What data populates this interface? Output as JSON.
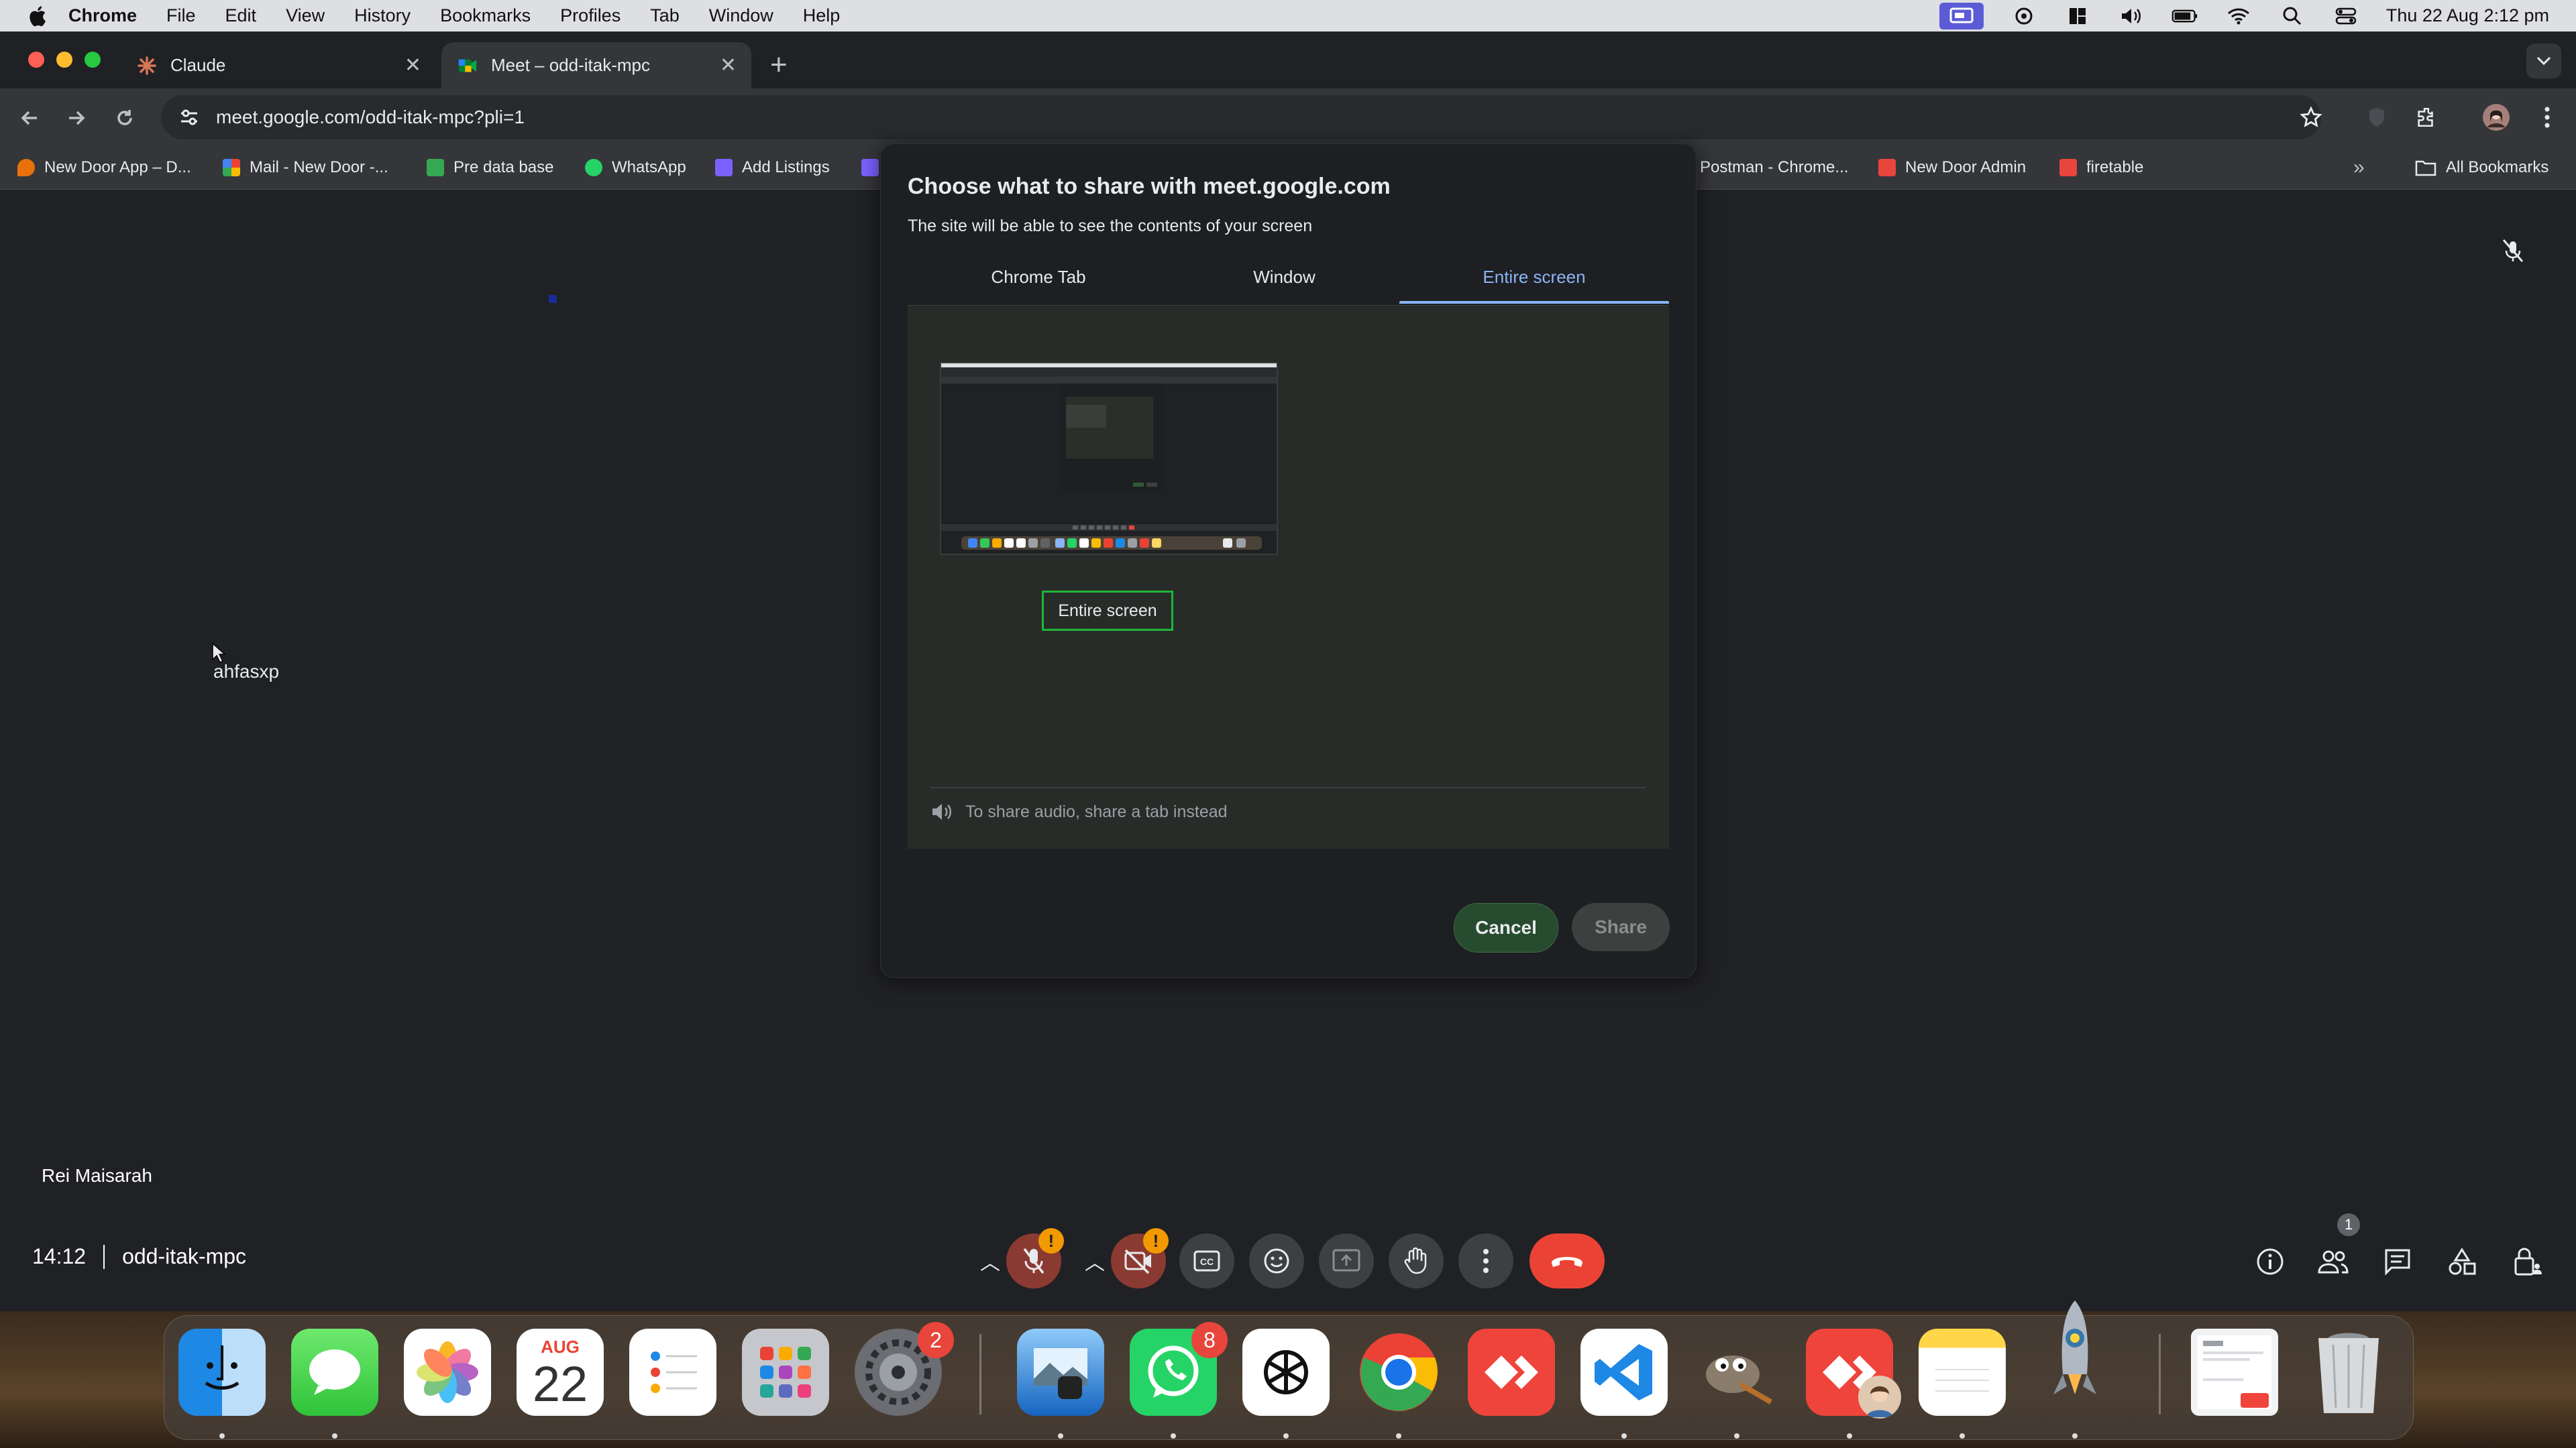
{
  "menubar": {
    "app_name": "Chrome",
    "items": [
      "File",
      "Edit",
      "View",
      "History",
      "Bookmarks",
      "Profiles",
      "Tab",
      "Window",
      "Help"
    ],
    "clock": "Thu 22 Aug  2:12 pm"
  },
  "tabs": [
    {
      "title": "Claude",
      "icon": "claude-icon"
    },
    {
      "title": "Meet – odd-itak-mpc",
      "icon": "google-meet-icon",
      "active": true
    }
  ],
  "address_bar": {
    "url": "meet.google.com/odd-itak-mpc?pli=1"
  },
  "bookmarks": {
    "items": [
      {
        "label": "New Door App – D...",
        "color": "#e8710a"
      },
      {
        "label": "Mail - New Door -...",
        "color": "#ea4335"
      },
      {
        "label": "Pre data base",
        "color": "#34a853"
      },
      {
        "label": "WhatsApp",
        "color": "#25d366"
      },
      {
        "label": "Add Listings",
        "color": "#7b61ff"
      },
      {
        "label": "Postman - Chrome...",
        "color": "#ff6c37"
      },
      {
        "label": "New Door Admin",
        "color": "#e8453c"
      },
      {
        "label": "firetable",
        "color": "#e8453c"
      }
    ],
    "all_bookmarks": "All Bookmarks"
  },
  "share_dialog": {
    "title": "Choose what to share with meet.google.com",
    "subtitle": "The site will be able to see the contents of your screen",
    "tabs": [
      "Chrome Tab",
      "Window",
      "Entire screen"
    ],
    "selected_tab": "Entire screen",
    "source_label": "Entire screen",
    "audio_note": "To share audio, share a tab instead",
    "cancel_label": "Cancel",
    "share_label": "Share",
    "accent_color": "#8ab4f8"
  },
  "stage": {
    "stray_text": "ahfasxp",
    "participant_name": "Rei Maisarah"
  },
  "meeting": {
    "time": "14:12",
    "code": "odd-itak-mpc",
    "participant_count": "1",
    "mic_warning": "!",
    "cam_warning": "!"
  },
  "dock": {
    "apps": [
      "Finder",
      "Messages",
      "Photos",
      "Calendar",
      "Reminders",
      "Launchpad",
      "System Settings",
      "Preview",
      "WhatsApp",
      "ChatGPT",
      "Google Chrome",
      "AnyDesk",
      "Visual Studio Code",
      "GIMP",
      "AnyDesk",
      "Notes",
      "Python"
    ],
    "calendar_month": "AUG",
    "calendar_day": "22",
    "settings_badge": "2",
    "whatsapp_badge": "8"
  }
}
